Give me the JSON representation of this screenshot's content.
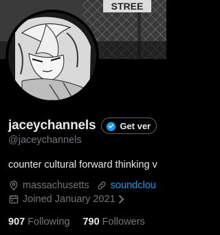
{
  "profile": {
    "banner_sign_text": "STREE",
    "display_name": "jaceychannels",
    "verify_button_label": "Get ver",
    "handle": "@jaceychannels",
    "bio": "counter cultural forward thinking v",
    "location": "massachusetts",
    "website": "soundclou",
    "joined": "Joined January 2021",
    "following_count": "907",
    "following_label": "Following",
    "followers_count": "790",
    "followers_label": "Followers"
  },
  "colors": {
    "background": "#000000",
    "text_primary": "#e7e9ea",
    "text_secondary": "#71767b",
    "link": "#1d9bf0",
    "verified_badge": "#1d9bf0"
  },
  "icons": [
    "verified-badge-icon",
    "location-pin-icon",
    "link-icon",
    "calendar-icon",
    "chevron-right-icon"
  ]
}
